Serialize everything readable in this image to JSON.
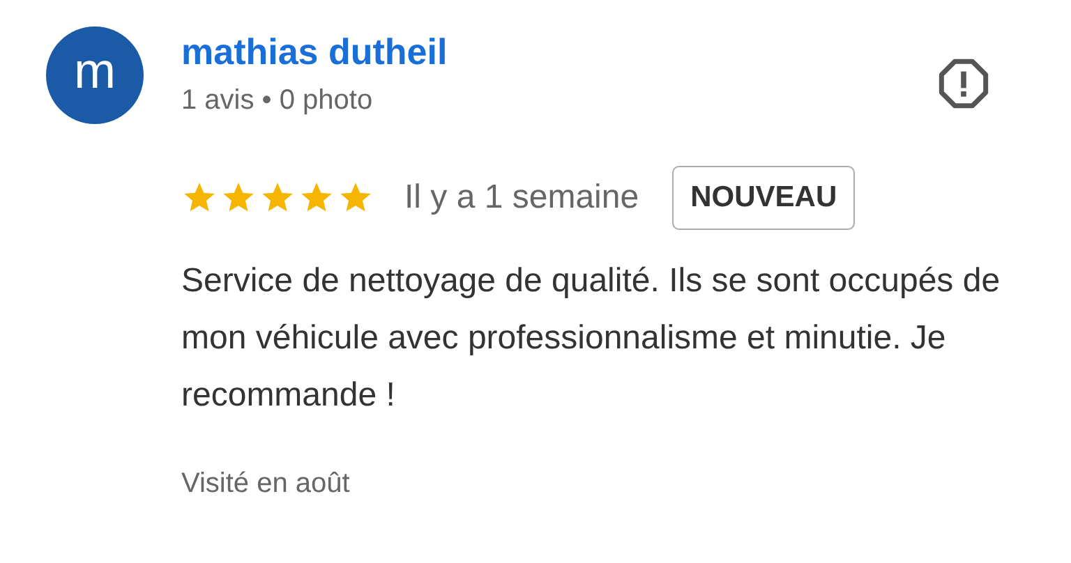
{
  "reviewer": {
    "initial": "m",
    "name": "mathias dutheil",
    "meta": "1 avis • 0 photo"
  },
  "rating": {
    "stars": 5,
    "time": "Il y a 1 semaine",
    "badge": "NOUVEAU"
  },
  "text": "Service de nettoyage de qualité. Ils se sont occupés de mon véhicule avec professionnalisme et minutie. Je recommande !",
  "visited": "Visité en août"
}
